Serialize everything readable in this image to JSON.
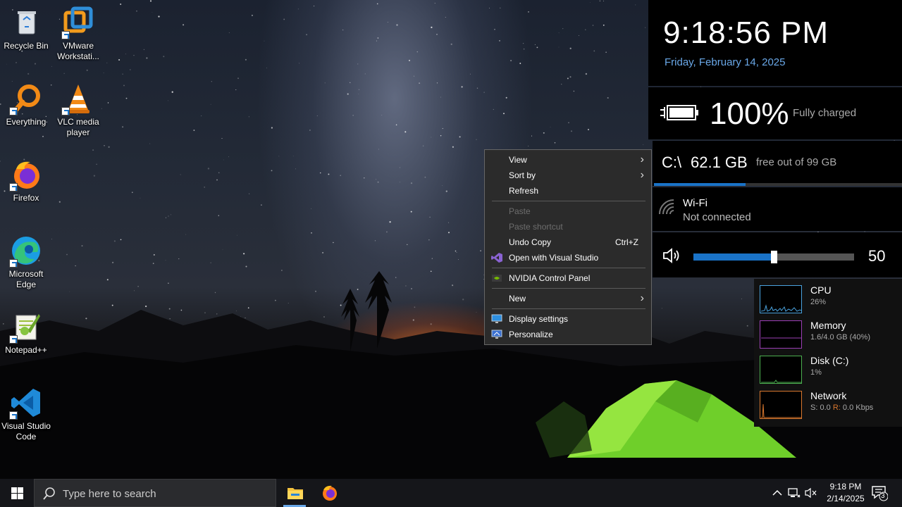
{
  "desktop": {
    "icons": [
      {
        "label": "Recycle Bin"
      },
      {
        "label": "VMware Workstati..."
      },
      {
        "label": "Everything"
      },
      {
        "label": "VLC media player"
      },
      {
        "label": "Firefox"
      },
      {
        "label": "Microsoft Edge"
      },
      {
        "label": "Notepad++"
      },
      {
        "label": "Visual Studio Code"
      }
    ]
  },
  "widgets": {
    "clock": {
      "time": "9:18:56 PM",
      "date": "Friday, February 14, 2025"
    },
    "battery": {
      "percent": "100%",
      "status": "Fully charged",
      "icon": "battery-plug-icon"
    },
    "disk": {
      "drive": "C:\\",
      "free": "62.1 GB",
      "total": "free out of 99 GB",
      "used_fraction": 0.37
    },
    "wifi": {
      "label": "Wi-Fi",
      "status": "Not connected",
      "icon": "wifi-icon"
    },
    "volume": {
      "level": 50,
      "level_label": "50",
      "icon": "speaker-icon"
    }
  },
  "perf": {
    "cpu": {
      "name": "CPU",
      "value": "26%",
      "color": "#4aa3df"
    },
    "memory": {
      "name": "Memory",
      "value": "1.6/4.0 GB (40%)",
      "color": "#9b3fb5"
    },
    "disk": {
      "name": "Disk (C:)",
      "value": "1%",
      "color": "#4caf50"
    },
    "network": {
      "name": "Network",
      "value_s_label": "S:",
      "value_s": "0.0",
      "value_r_label": "R:",
      "value_r": "0.0 Kbps",
      "color": "#d9772e"
    }
  },
  "context_menu": {
    "view": "View",
    "sort_by": "Sort by",
    "refresh": "Refresh",
    "paste": "Paste",
    "paste_shortcut": "Paste shortcut",
    "undo_copy": "Undo Copy",
    "undo_copy_shortcut": "Ctrl+Z",
    "open_with_vs": "Open with Visual Studio",
    "nvidia": "NVIDIA Control Panel",
    "new": "New",
    "display_settings": "Display settings",
    "personalize": "Personalize"
  },
  "taskbar": {
    "search_placeholder": "Type here to search",
    "apps": [
      "File Explorer",
      "Firefox"
    ],
    "tray": {
      "time": "9:18 PM",
      "date": "2/14/2025",
      "notifications_count": "3"
    }
  },
  "colors": {
    "accent": "#1a73c8",
    "date_blue": "#6aa8e8"
  }
}
